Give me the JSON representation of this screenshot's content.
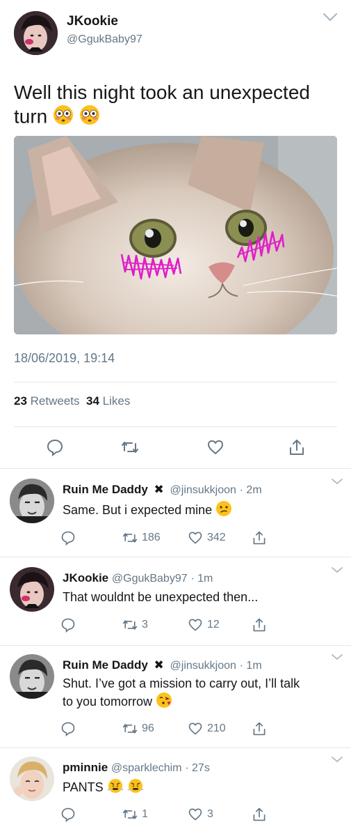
{
  "tweet": {
    "name": "JKookie",
    "handle": "@GgukBaby97",
    "text_line1": "Well this night took an unexpected",
    "text_line2": "turn",
    "text_emoji": "flushed-face-emoji x2",
    "timestamp": "18/06/2019, 19:14",
    "retweets_count": "23",
    "retweets_label": "Retweets",
    "likes_count": "34",
    "likes_label": "Likes",
    "actions": [
      "reply-icon",
      "retweet-icon",
      "like-icon",
      "share-icon"
    ]
  },
  "replies": [
    {
      "name": "Ruin Me Daddy",
      "badge": "✖",
      "handle": "@jinsukkjoon",
      "time": "· 2m",
      "text": "Same. But i expected mine",
      "emoji": "confused-face-emoji",
      "retweets": "186",
      "likes": "342"
    },
    {
      "name": "JKookie",
      "handle": "@GgukBaby97",
      "time": "· 1m",
      "text": "That wouldnt be unexpected then...",
      "retweets": "3",
      "likes": "12"
    },
    {
      "name": "Ruin Me Daddy",
      "badge": "✖",
      "handle": "@jinsukkjoon",
      "time": "· 1m",
      "text_line1": "Shut. I’ve got a mission to carry out, I’ll talk",
      "text_line2": "to you tomorrow",
      "emoji": "face-blowing-kiss-emoji",
      "retweets": "96",
      "likes": "210"
    },
    {
      "name": "pminnie",
      "handle": "@sparklechim",
      "time": "· 27s",
      "text": "PANTS",
      "emoji": "face-with-steam-emoji x2",
      "retweets": "1",
      "likes": "3"
    }
  ],
  "colors": {
    "text": "#14171a",
    "muted": "#657786",
    "divider": "#e1e8ed",
    "emoji_yellow": "#fcc21b",
    "blush_pink": "#e01ec8"
  }
}
